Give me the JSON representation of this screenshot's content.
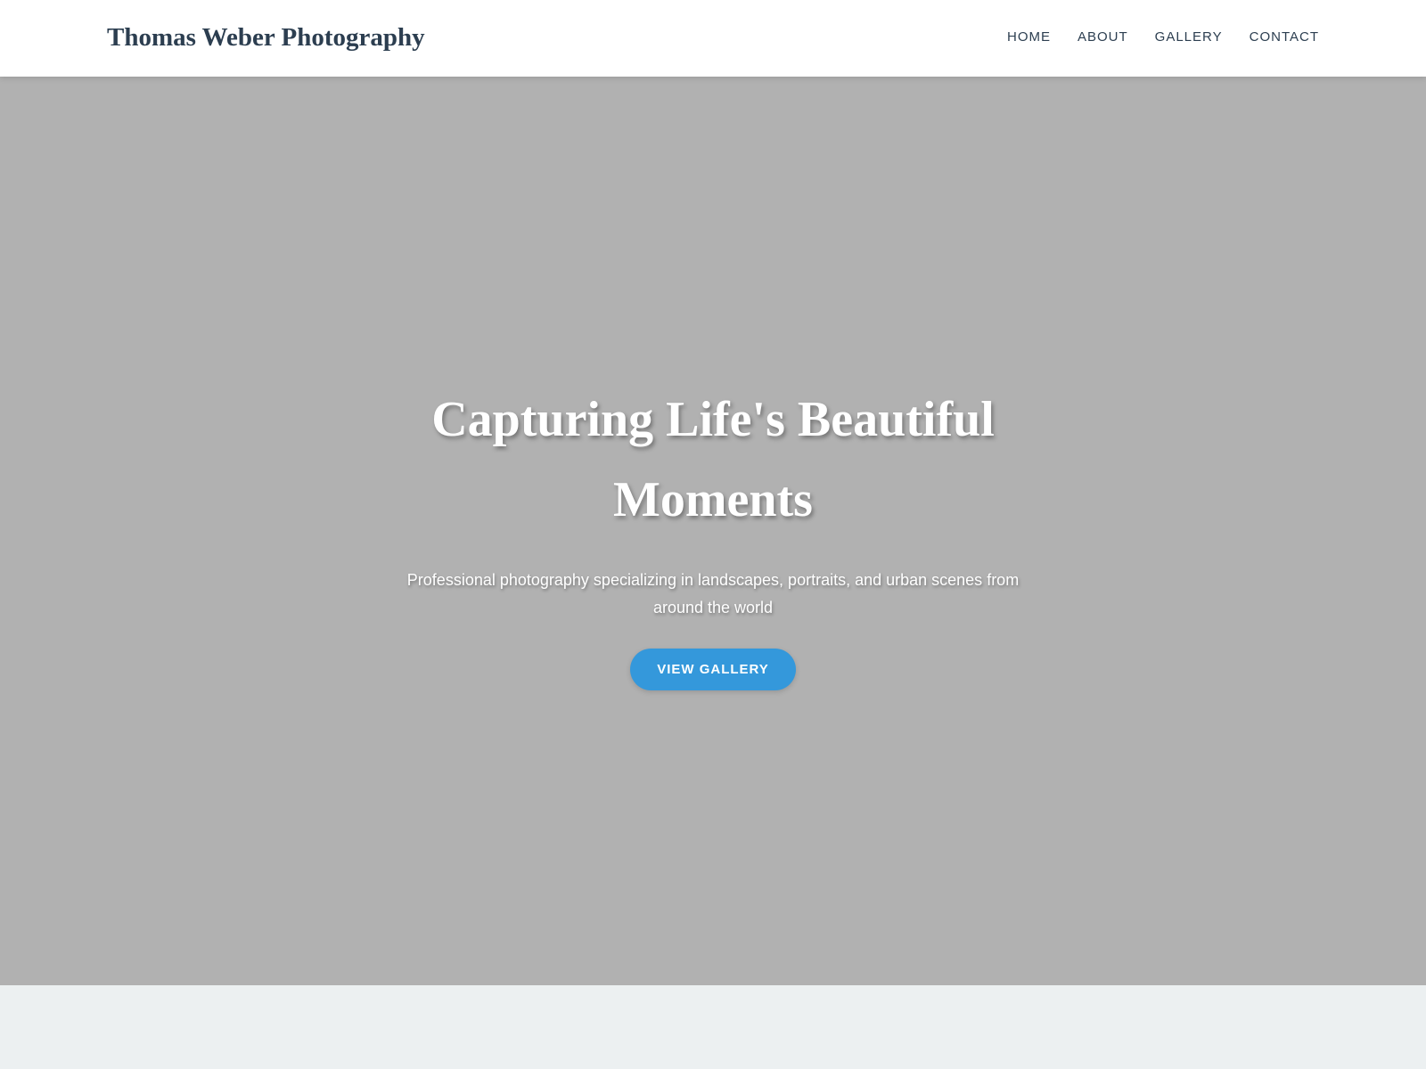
{
  "header": {
    "brand": "Thomas Weber Photography",
    "nav": [
      {
        "label": "HOME"
      },
      {
        "label": "ABOUT"
      },
      {
        "label": "GALLERY"
      },
      {
        "label": "CONTACT"
      }
    ]
  },
  "hero": {
    "title": "Capturing Life's Beautiful Moments",
    "subtitle": "Professional photography specializing in landscapes, portraits, and urban scenes from around the world",
    "cta_label": "VIEW GALLERY"
  },
  "colors": {
    "brand_text": "#2c3e50",
    "hero_background": "#b1b1b1",
    "accent": "#3498db",
    "page_background": "#ecf0f1"
  }
}
